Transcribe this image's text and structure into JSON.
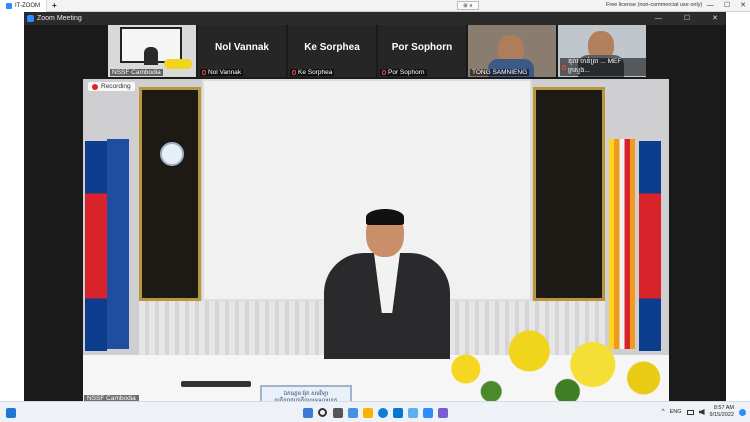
{
  "host_window": {
    "tab_title": "IT-ZOOM",
    "new_tab": "+",
    "license_text": "Free license (non-commercial use only)",
    "mini_toolbar": "⊞ ∨",
    "controls": [
      "—",
      "☐",
      "✕"
    ]
  },
  "zoom_window": {
    "title": "Zoom Meeting",
    "controls": [
      "—",
      "☐",
      "✕"
    ]
  },
  "participants": [
    {
      "name": "NSSF Cambodia",
      "type": "video"
    },
    {
      "name": "Nol Vannak",
      "big_label": "Nol Vannak",
      "type": "name",
      "muted": true
    },
    {
      "name": "Ke Sorphea",
      "big_label": "Ke Sorphea",
      "type": "name",
      "muted": true
    },
    {
      "name": "Por Sophorn",
      "big_label": "Por Sophorn",
      "type": "name",
      "muted": true
    },
    {
      "name": "TONG SAMNIENG",
      "type": "video"
    },
    {
      "name": "ឌុល ចាន់ត្រា ... MEF ក្រសួង...",
      "type": "video",
      "muted": true
    }
  ],
  "strip_next_icon": "›",
  "recording_label": "Recording",
  "active_speaker_label": "NSSF Cambodia",
  "nameplate_text": "ឯកឧត្តម អ៊ុក សមវិទ្យា\nប្រតិភូរាជរដ្ឋាភិបាលទទួលបន្ទុក\nអគ្គនាយកបេឡាជាតិរបបសន្តិសុខសង្គម",
  "taskbar": {
    "language": "ENG",
    "time": "8:57 AM",
    "date": "9/15/2022"
  },
  "colors": {
    "zoom_blue": "#2d8cff",
    "zoom_dark": "#1a1a1a",
    "recording_red": "#e02424"
  }
}
